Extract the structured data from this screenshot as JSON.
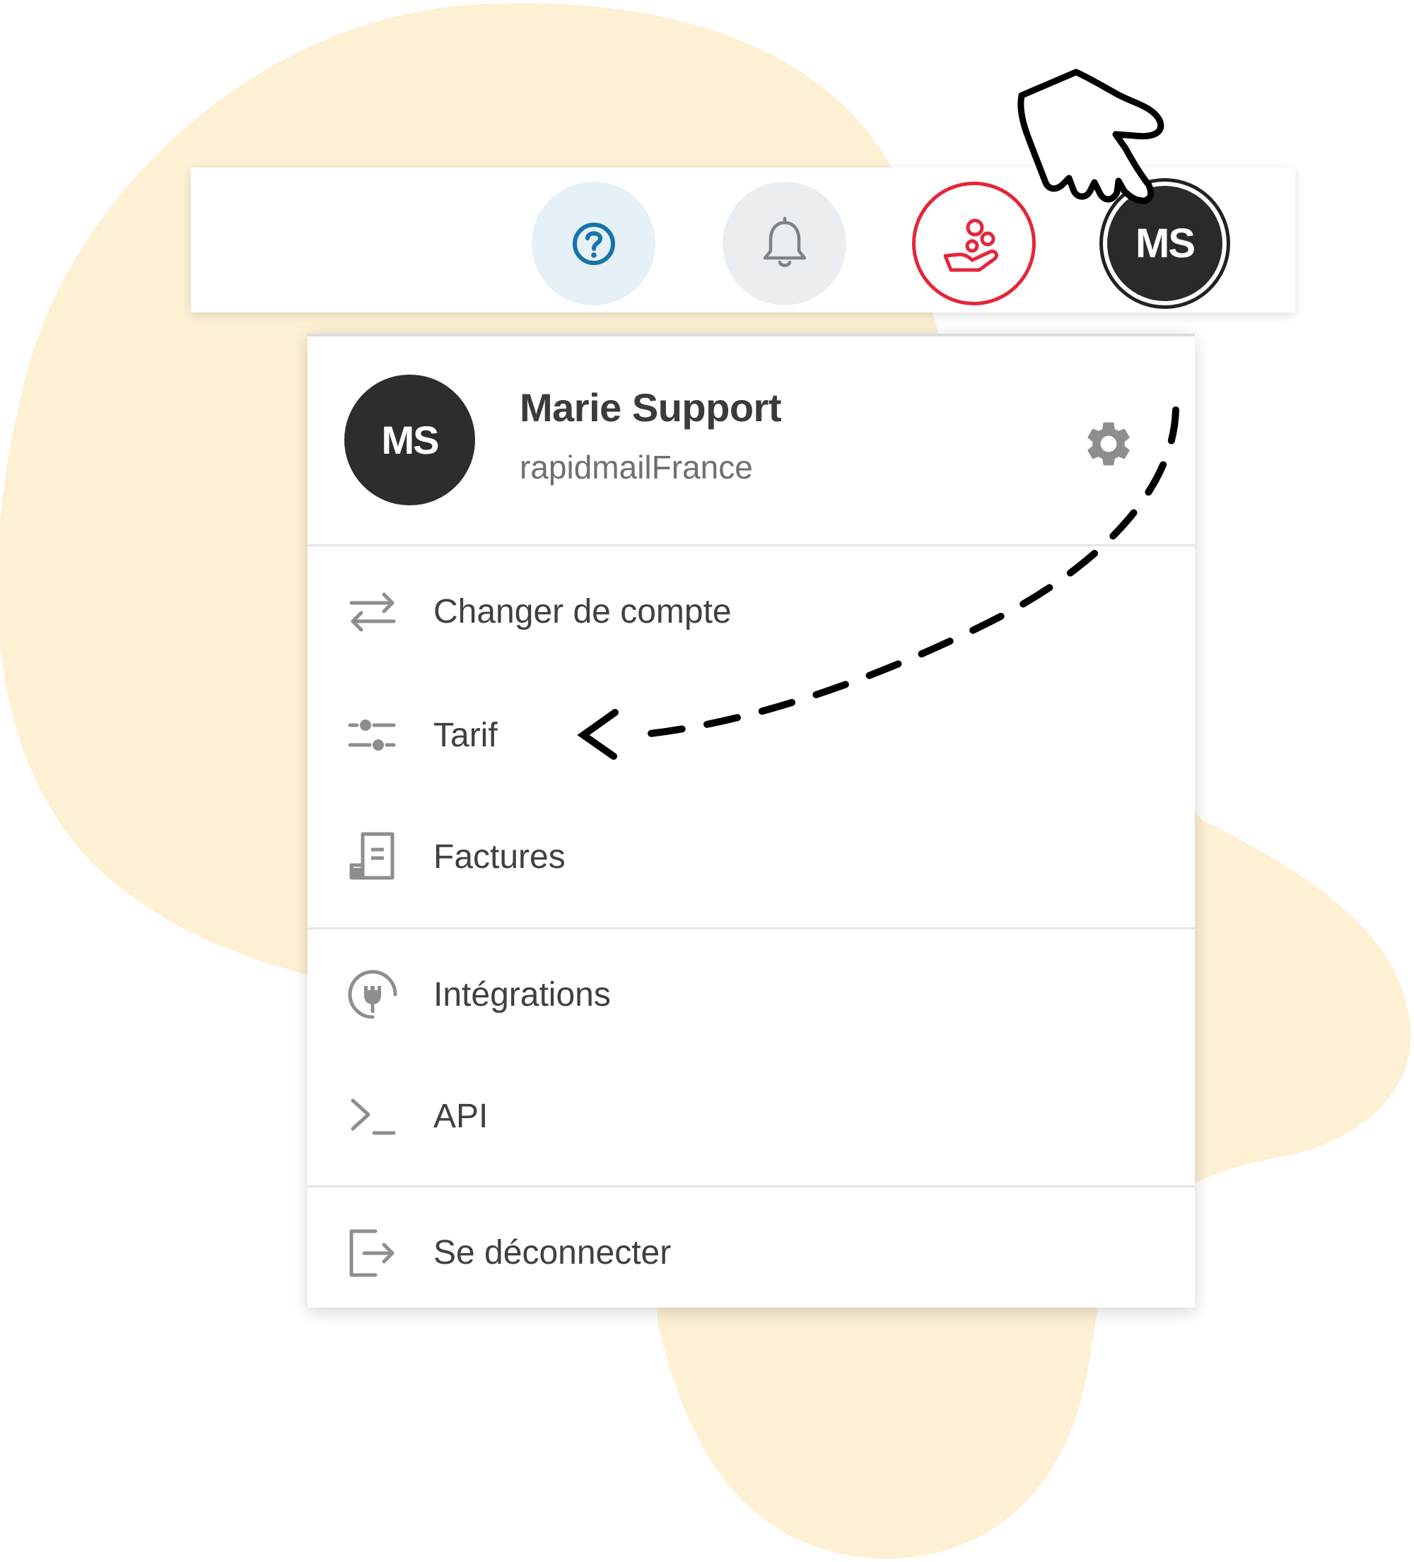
{
  "colors": {
    "background_blob": "#fdf0d3",
    "help_accent": "#1673a8",
    "offer_accent": "#e3263b",
    "avatar_bg": "#2d2d2d",
    "icon_gray": "#8e8e8e"
  },
  "topbar": {
    "help_icon": "question-circle-icon",
    "bell_icon": "bell-icon",
    "offer_icon": "hand-coins-icon",
    "avatar_initials": "MS"
  },
  "menu": {
    "profile": {
      "initials": "MS",
      "name": "Marie Support",
      "account": "rapidmailFrance",
      "settings_icon": "gear-icon"
    },
    "items": [
      {
        "label": "Changer de compte",
        "icon": "swap-arrows-icon"
      },
      {
        "label": "Tarif",
        "icon": "sliders-icon"
      },
      {
        "label": "Factures",
        "icon": "invoice-icon"
      },
      {
        "label": "Intégrations",
        "icon": "plug-circle-icon"
      },
      {
        "label": "API",
        "icon": "terminal-icon"
      },
      {
        "label": "Se déconnecter",
        "icon": "logout-icon"
      }
    ]
  },
  "annotations": {
    "pointer": "hand-pointer-icon",
    "arrow": "dashed-arrow-icon"
  }
}
